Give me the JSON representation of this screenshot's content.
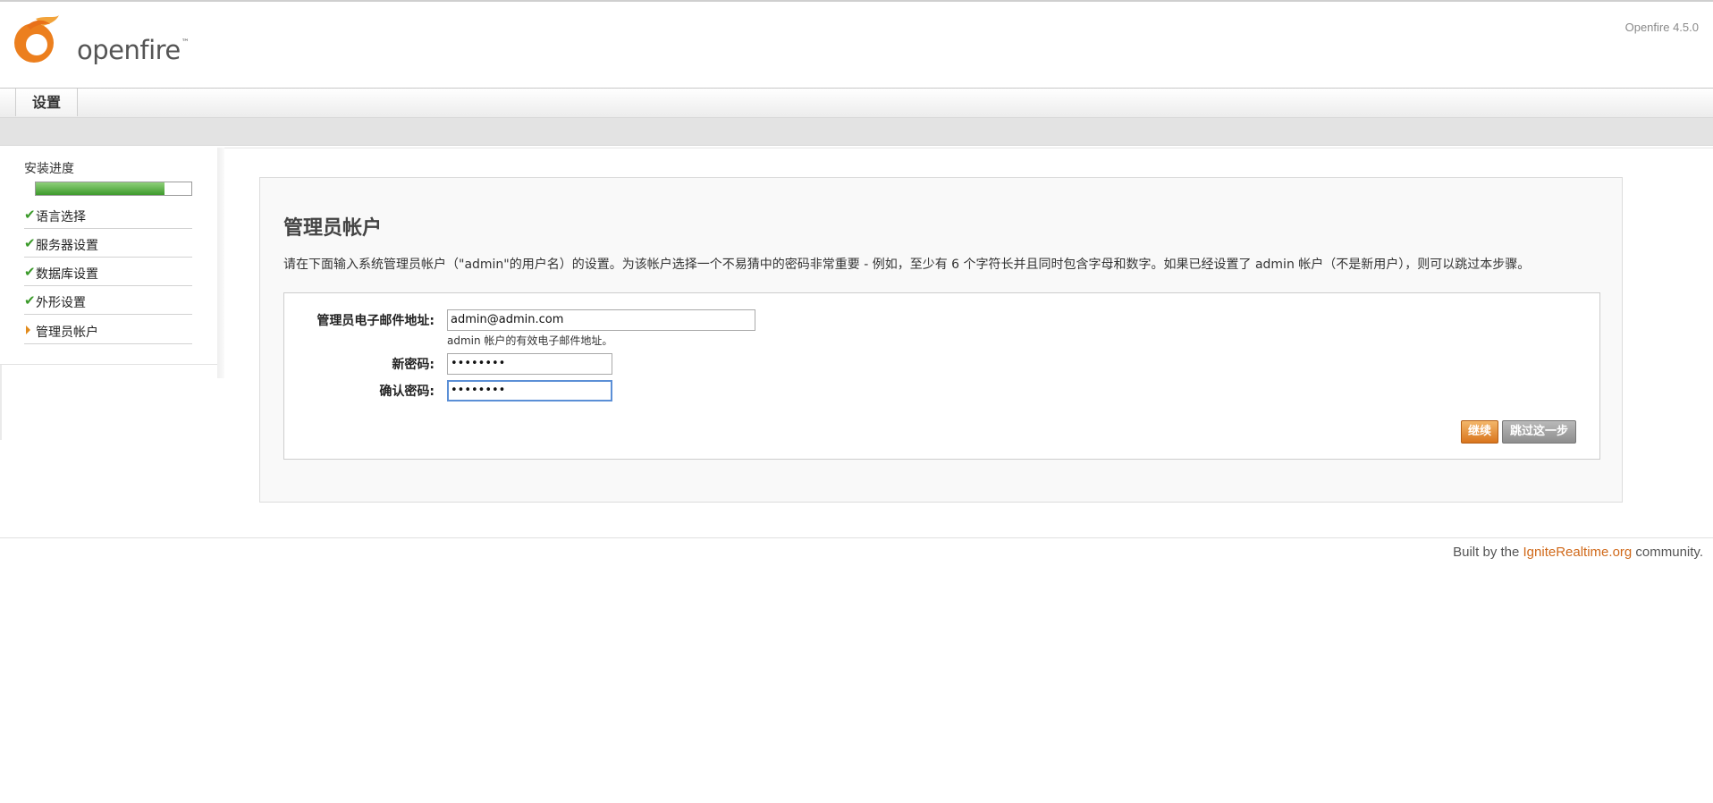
{
  "app": {
    "logo_text": "openfire",
    "logo_tm": "™",
    "version": "Openfire 4.5.0"
  },
  "nav": {
    "tab_settings": "设置"
  },
  "sidebar": {
    "progress_title": "安装进度",
    "progress": 0.83,
    "steps": [
      {
        "label": "语言选择",
        "status": "done"
      },
      {
        "label": "服务器设置",
        "status": "done"
      },
      {
        "label": "数据库设置",
        "status": "done"
      },
      {
        "label": "外形设置",
        "status": "done"
      },
      {
        "label": "管理员帐户",
        "status": "current"
      }
    ]
  },
  "main": {
    "title": "管理员帐户",
    "description": "请在下面输入系统管理员帐户（\"admin\"的用户名）的设置。为该帐户选择一个不易猜中的密码非常重要 - 例如，至少有 6 个字符长并且同时包含字母和数字。如果已经设置了 admin 帐户（不是新用户），则可以跳过本步骤。",
    "form": {
      "email_label": "管理员电子邮件地址:",
      "email_value": "admin@admin.com",
      "email_hint": "admin 帐户的有效电子邮件地址。",
      "new_password_label": "新密码:",
      "new_password_value": "••••••••",
      "confirm_password_label": "确认密码:",
      "confirm_password_value": "••••••••"
    },
    "buttons": {
      "continue": "继续",
      "skip": "跳过这一步"
    }
  },
  "footer": {
    "prefix": "Built by the ",
    "link": "IgniteRealtime.org",
    "suffix": " community."
  }
}
